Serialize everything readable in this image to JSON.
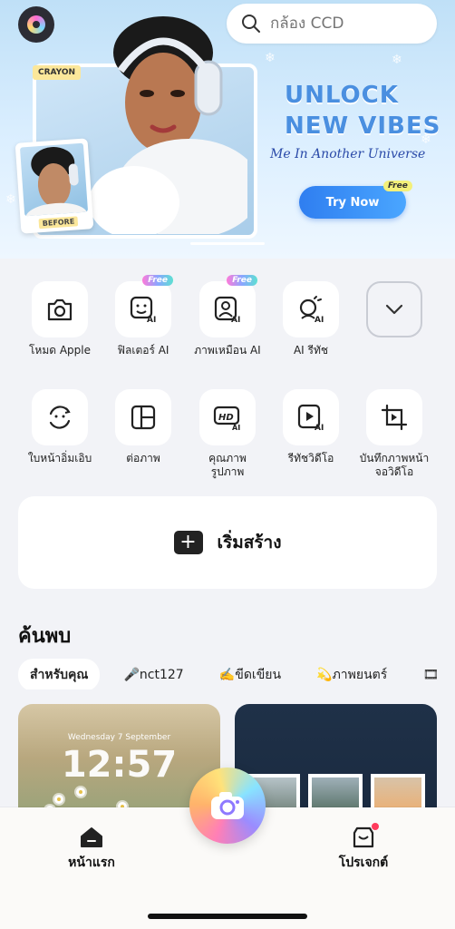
{
  "search": {
    "placeholder": "กล้อง CCD"
  },
  "banner": {
    "crayon_tag": "CRAYON",
    "before_tag": "BEFORE",
    "headline_line1": "UNLOCK",
    "headline_line2": "NEW VIBES",
    "subline": "Me In Another Universe",
    "cta_label": "Try Now",
    "cta_badge": "Free"
  },
  "tools_row1": [
    {
      "label": "โหมด Apple",
      "icon": "camera-icon",
      "badge": ""
    },
    {
      "label": "ฟิลเตอร์ AI",
      "icon": "ai-filter-icon",
      "badge": "Free"
    },
    {
      "label": "ภาพเหมือน AI",
      "icon": "ai-portrait-icon",
      "badge": "Free"
    },
    {
      "label": "AI รีทัช",
      "icon": "ai-retouch-icon",
      "badge": ""
    },
    {
      "label": "",
      "icon": "chevron-down-icon",
      "badge": ""
    }
  ],
  "tools_row2": [
    {
      "label": "ใบหน้าอิ่มเอิบ",
      "icon": "face-refresh-icon"
    },
    {
      "label": "ต่อภาพ",
      "icon": "collage-icon"
    },
    {
      "label": "คุณภาพ\nรูปภาพ",
      "icon": "hd-ai-icon"
    },
    {
      "label": "รีทัชวิดีโอ",
      "icon": "video-ai-icon"
    },
    {
      "label": "บันทึกภาพหน้า\nจอวิดีโอ",
      "icon": "screen-record-icon"
    }
  ],
  "create": {
    "label": "เริ่มสร้าง"
  },
  "discover": {
    "title": "ค้นพบ",
    "chips": [
      "สำหรับคุณ",
      "🎤nct127",
      "✍️ขีดเขียน",
      "💫ภาพยนตร์",
      "🎞"
    ],
    "card_left": {
      "date": "Wednesday 7 September",
      "time": "12:57"
    }
  },
  "tabbar": {
    "home_label": "หน้าแรก",
    "projects_label": "โปรเจกต์"
  }
}
